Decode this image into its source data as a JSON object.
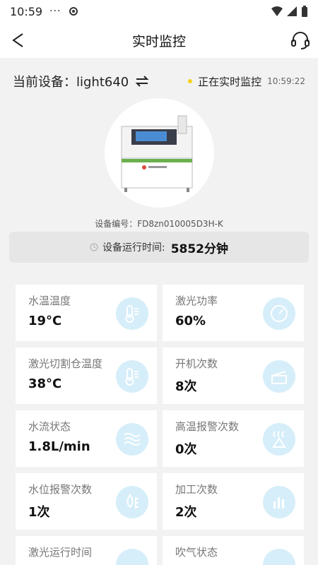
{
  "status": {
    "time": "10:59",
    "dots": "···"
  },
  "nav": {
    "title": "实时监控"
  },
  "device": {
    "label": "当前设备：light640",
    "live_text": "正在实时监控",
    "clock": "10:59:22",
    "serial": "设备编号：FD8zn010005D3H-K"
  },
  "runtime": {
    "label": "设备运行时间:",
    "value": "5852分钟"
  },
  "cards": [
    {
      "name": "水温温度",
      "value": "19°C",
      "icon": "thermometer-icon"
    },
    {
      "name": "激光功率",
      "value": "60%",
      "icon": "gauge-icon"
    },
    {
      "name": "激光切割仓温度",
      "value": "38°C",
      "icon": "thermometer-icon"
    },
    {
      "name": "开机次数",
      "value": "8次",
      "icon": "lid-box-icon"
    },
    {
      "name": "水流状态",
      "value": "1.8L/min",
      "icon": "water-waves-icon"
    },
    {
      "name": "高温报警次数",
      "value": "0次",
      "icon": "heat-warning-icon"
    },
    {
      "name": "水位报警次数",
      "value": "1次",
      "icon": "water-level-icon"
    },
    {
      "name": "加工次数",
      "value": "2次",
      "icon": "bar-chart-icon"
    },
    {
      "name": "激光运行时间",
      "value": "",
      "icon": "clock-icon"
    },
    {
      "name": "吹气状态",
      "value": "",
      "icon": "air-icon"
    }
  ],
  "colors": {
    "accent": "#8fd3f0",
    "icon_bg": "#d6eef9",
    "live_dot": "#f5d31b"
  }
}
